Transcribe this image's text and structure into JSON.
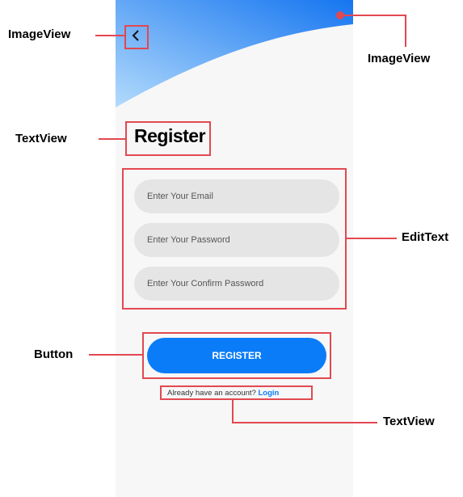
{
  "screen": {
    "back_icon": "chevron-left-icon",
    "title": "Register",
    "fields": [
      {
        "placeholder": "Enter Your Email"
      },
      {
        "placeholder": "Enter Your Password"
      },
      {
        "placeholder": "Enter Your Confirm Password"
      }
    ],
    "button_label": "REGISTER",
    "account_prompt": "Already have an account?",
    "login_link": "Login",
    "colors": {
      "primary": "#0b7cf7",
      "header_gradient": [
        "#1575f0",
        "#a9d5fb"
      ],
      "field_bg": "#e5e5e5"
    }
  },
  "annotations": {
    "back_image": "ImageView",
    "header_image": "ImageView",
    "title_text": "TextView",
    "inputs": "EditText",
    "button": "Button",
    "login_text": "TextView",
    "color": "#e34850"
  }
}
